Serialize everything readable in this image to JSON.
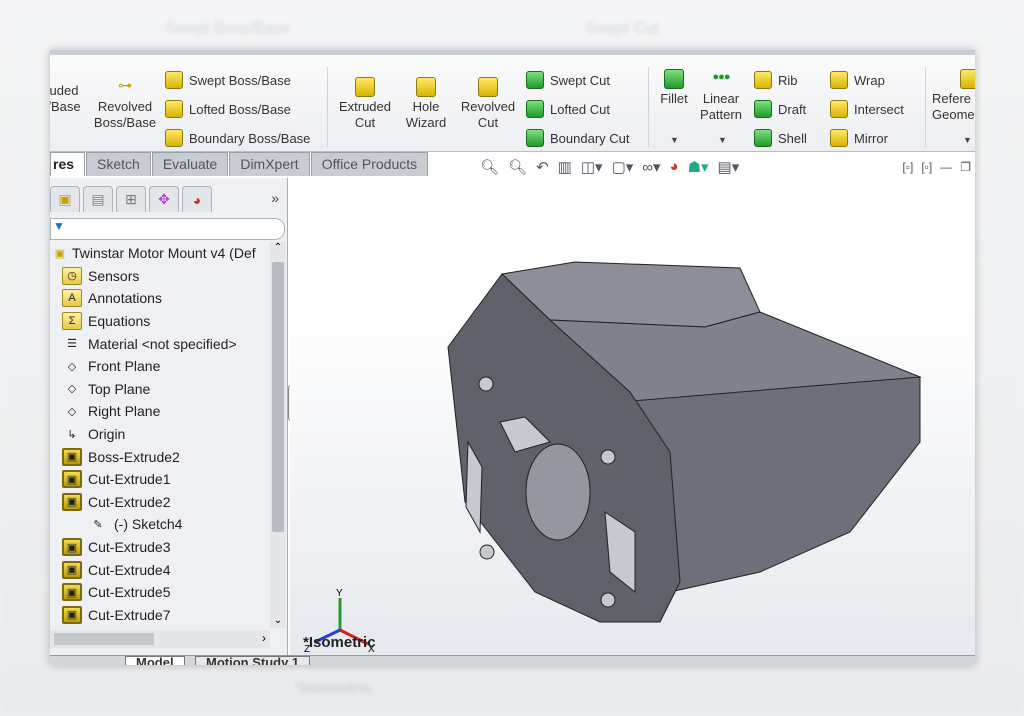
{
  "ribbon": {
    "extruded_boss": "uded\n/Base",
    "revolved_boss": "Revolved\nBoss/Base",
    "swept_boss": "Swept Boss/Base",
    "lofted_boss": "Lofted Boss/Base",
    "boundary_boss": "Boundary Boss/Base",
    "extruded_cut": "Extruded\nCut",
    "hole_wizard": "Hole\nWizard",
    "revolved_cut": "Revolved\nCut",
    "swept_cut": "Swept Cut",
    "lofted_cut": "Lofted Cut",
    "boundary_cut": "Boundary Cut",
    "fillet": "Fillet",
    "linear_pattern": "Linear\nPattern",
    "rib": "Rib",
    "draft": "Draft",
    "shell": "Shell",
    "wrap": "Wrap",
    "intersect": "Intersect",
    "mirror": "Mirror",
    "reference_geometry": "Refere\nGeome"
  },
  "tabs": [
    "res",
    "Sketch",
    "Evaluate",
    "DimXpert",
    "Office Products"
  ],
  "tree": {
    "root": "Twinstar Motor Mount v4  (Def",
    "items": [
      {
        "label": "Sensors",
        "icon": "sensor-folder-icon"
      },
      {
        "label": "Annotations",
        "icon": "annotations-folder-icon"
      },
      {
        "label": "Equations",
        "icon": "equations-folder-icon"
      },
      {
        "label": "Material <not specified>",
        "icon": "material-icon"
      },
      {
        "label": "Front Plane",
        "icon": "plane-icon"
      },
      {
        "label": "Top Plane",
        "icon": "plane-icon"
      },
      {
        "label": "Right Plane",
        "icon": "plane-icon"
      },
      {
        "label": "Origin",
        "icon": "origin-icon"
      },
      {
        "label": "Boss-Extrude2",
        "icon": "boss-extrude-icon"
      },
      {
        "label": "Cut-Extrude1",
        "icon": "cut-extrude-icon"
      },
      {
        "label": "Cut-Extrude2",
        "icon": "cut-extrude-icon"
      },
      {
        "label": "(-) Sketch4",
        "icon": "sketch-icon"
      },
      {
        "label": "Cut-Extrude3",
        "icon": "cut-extrude-icon"
      },
      {
        "label": "Cut-Extrude4",
        "icon": "cut-extrude-icon"
      },
      {
        "label": "Cut-Extrude5",
        "icon": "cut-extrude-icon"
      },
      {
        "label": "Cut-Extrude7",
        "icon": "cut-extrude-icon"
      }
    ]
  },
  "viewport": {
    "view_name": "*Isometric",
    "model_color": "#6d6f7a"
  },
  "bottom_tabs": [
    "Model",
    "Motion Study 1"
  ]
}
